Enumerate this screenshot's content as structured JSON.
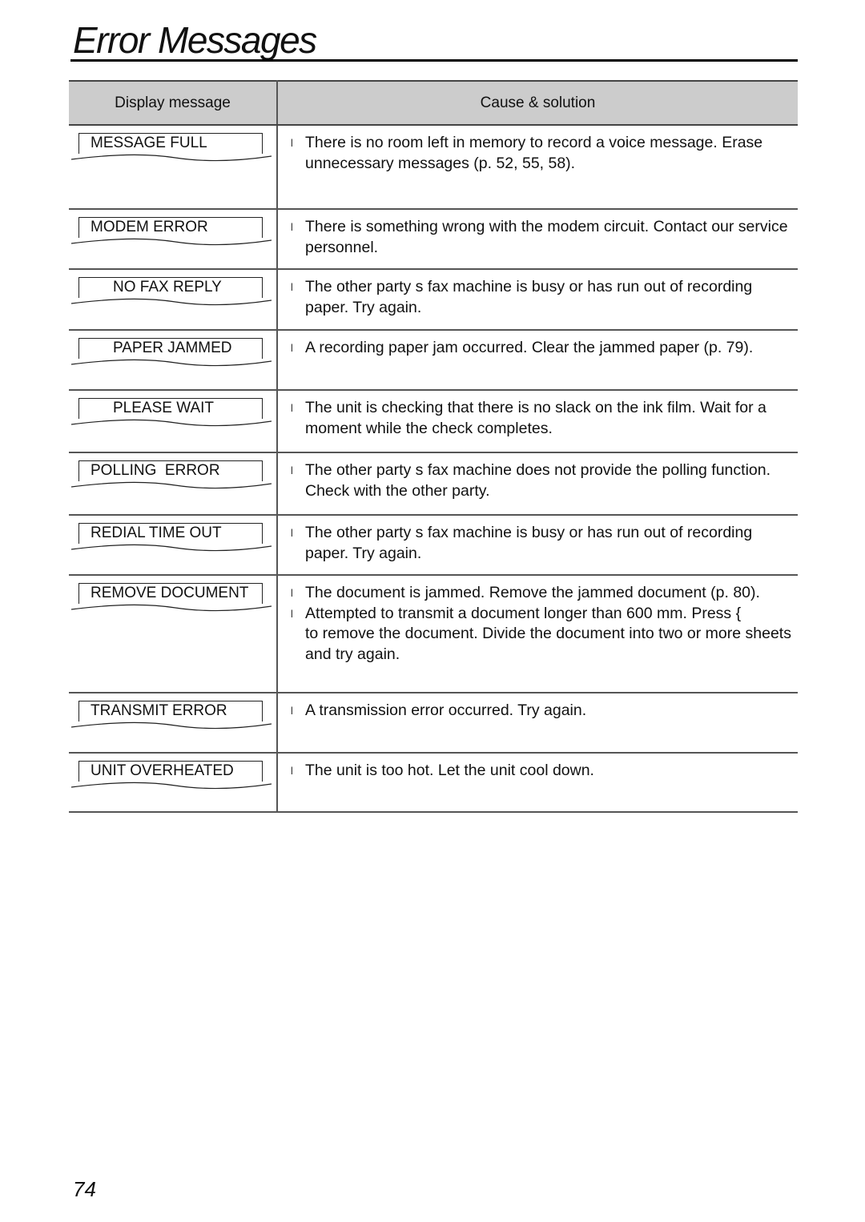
{
  "page_title": "Error Messages",
  "page_number": "74",
  "table": {
    "headers": {
      "display": "Display message",
      "cause": "Cause & solution"
    },
    "bullet_glyph": "l",
    "rows": [
      {
        "display": "MESSAGE FULL",
        "indent": false,
        "causes": [
          "There is no room left in memory to record a voice message. Erase unnecessary messages (p. 52, 55, 58)."
        ]
      },
      {
        "display": "MODEM ERROR",
        "indent": false,
        "causes": [
          "There is something wrong with the modem circuit. Contact our service personnel."
        ]
      },
      {
        "display": "NO FAX REPLY",
        "indent": true,
        "causes": [
          "The other party s fax machine is busy or has run out of recording paper. Try again."
        ]
      },
      {
        "display": "PAPER JAMMED",
        "indent": true,
        "causes": [
          "A recording paper jam occurred. Clear the jammed paper (p. 79)."
        ]
      },
      {
        "display": "PLEASE WAIT",
        "indent": true,
        "causes": [
          "The unit is checking that there is no slack on the ink film. Wait for a moment while the check completes."
        ]
      },
      {
        "display": "POLLING  ERROR",
        "indent": false,
        "causes": [
          "The other party s fax machine does not provide the polling function. Check with the other party."
        ]
      },
      {
        "display": "REDIAL TIME OUT",
        "indent": false,
        "causes": [
          "The other party s fax machine is busy or has run out of recording paper. Try again."
        ]
      },
      {
        "display": "REMOVE DOCUMENT",
        "indent": false,
        "causes": [
          "The document is jammed. Remove the jammed document (p. 80).",
          "Attempted to transmit a document longer than 600 mm. Press {          to remove the document. Divide the document into two or more sheets and try again."
        ]
      },
      {
        "display": "TRANSMIT ERROR",
        "indent": false,
        "causes": [
          "A transmission error occurred. Try again."
        ]
      },
      {
        "display": "UNIT OVERHEATED",
        "indent": false,
        "causes": [
          "The unit is too hot. Let the unit cool down."
        ]
      }
    ]
  }
}
